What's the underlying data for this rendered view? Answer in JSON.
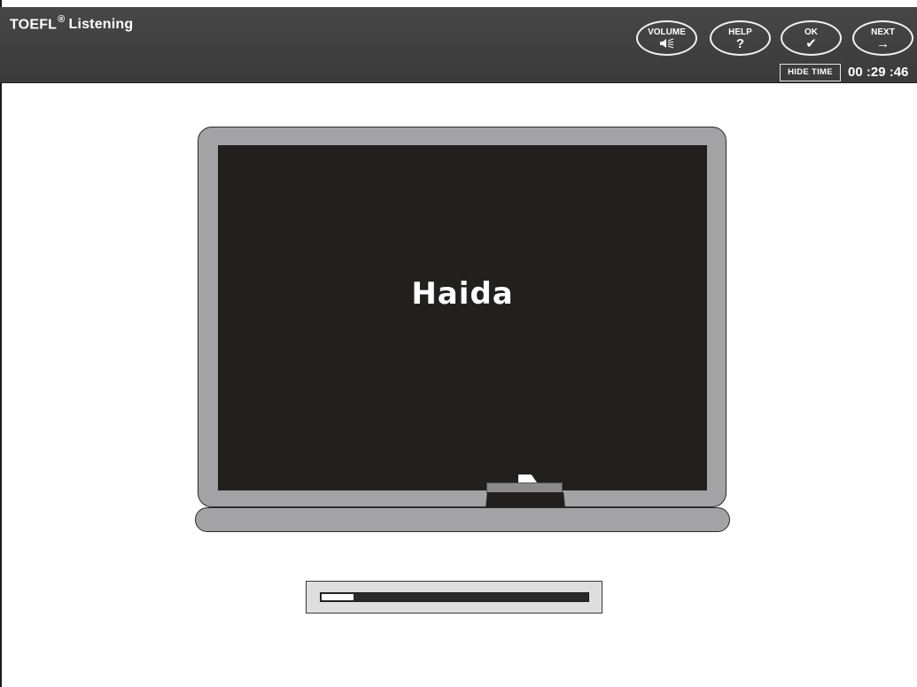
{
  "header": {
    "title_main": "TOEFL",
    "title_reg": "®",
    "title_rest": "Listening",
    "buttons": {
      "volume": {
        "label": "VOLUME",
        "icon": "speaker-icon",
        "glyph": "◀⦙"
      },
      "help": {
        "label": "HELP",
        "icon": "question-icon",
        "glyph": "?"
      },
      "ok": {
        "label": "OK",
        "icon": "checkmark-icon",
        "glyph": "✔"
      },
      "next": {
        "label": "NEXT",
        "icon": "arrow-right-icon",
        "glyph": "→"
      }
    },
    "hide_time_label": "HIDE TIME",
    "timer": "00 :29 :46"
  },
  "board": {
    "word": "Haida"
  },
  "progress": {
    "fraction": 0.12
  },
  "colors": {
    "header_bg": "#404040",
    "board_surface": "#221f1f",
    "board_frame": "#a3a3a6"
  }
}
